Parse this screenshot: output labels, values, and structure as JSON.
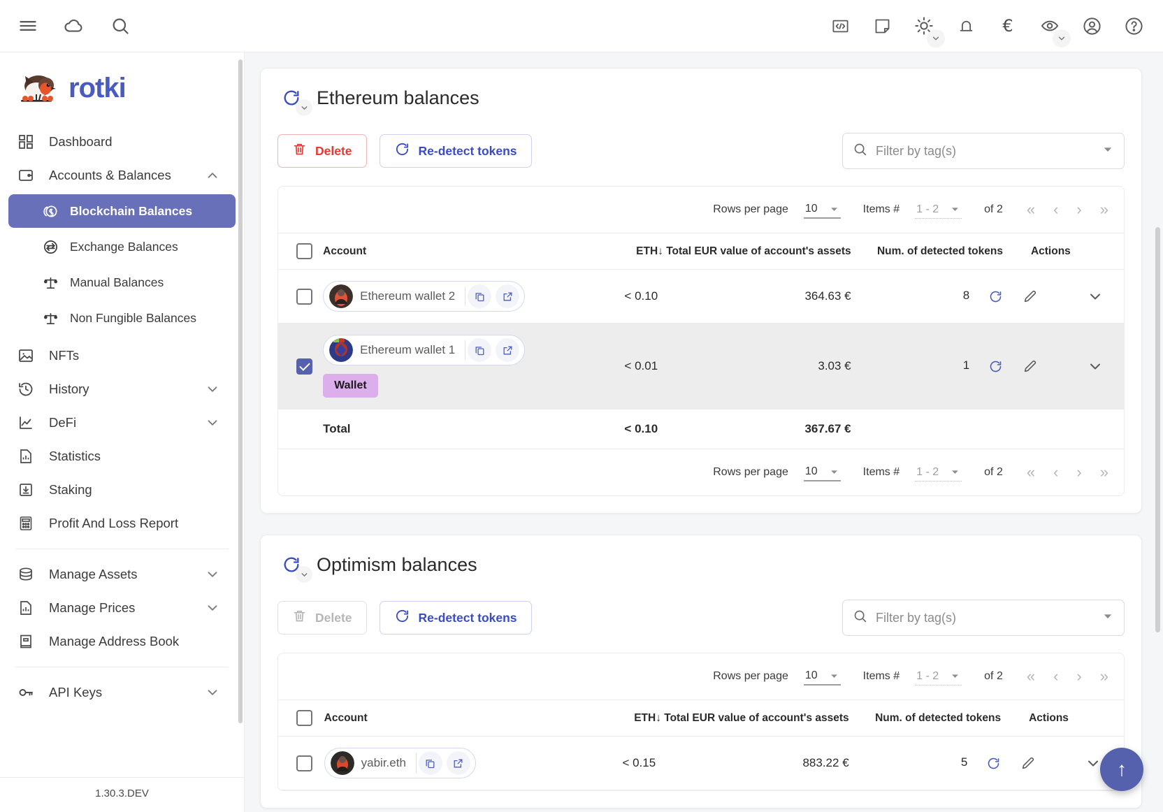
{
  "topbar": {
    "left_icons": [
      {
        "name": "menu-icon",
        "label": "Menu"
      },
      {
        "name": "cloud-icon",
        "label": "Cloud sync"
      },
      {
        "name": "search-icon",
        "label": "Search"
      }
    ],
    "right_icons": [
      {
        "name": "code-icon",
        "label": "Developer"
      },
      {
        "name": "note-icon",
        "label": "Notes"
      },
      {
        "name": "sun-icon",
        "label": "Theme"
      },
      {
        "name": "bell-icon",
        "label": "Notifications"
      },
      {
        "name": "euro-icon",
        "label": "€"
      },
      {
        "name": "eye-icon",
        "label": "Privacy mode"
      },
      {
        "name": "account-icon",
        "label": "Account"
      },
      {
        "name": "help-icon",
        "label": "Help"
      }
    ]
  },
  "sidebar": {
    "brand": "rotki",
    "version": "1.30.3.DEV",
    "items": [
      {
        "label": "Dashboard",
        "icon": "dashboard-icon",
        "type": "item"
      },
      {
        "label": "Accounts & Balances",
        "icon": "wallet-icon",
        "type": "group",
        "expanded": true
      },
      {
        "label": "Blockchain Balances",
        "icon": "coins-icon",
        "type": "sub",
        "active": true
      },
      {
        "label": "Exchange Balances",
        "icon": "exchange-icon",
        "type": "sub",
        "active": false
      },
      {
        "label": "Manual Balances",
        "icon": "scale-icon",
        "type": "sub",
        "active": false
      },
      {
        "label": "Non Fungible Balances",
        "icon": "scale-icon",
        "type": "sub",
        "active": false
      },
      {
        "label": "NFTs",
        "icon": "image-icon",
        "type": "item"
      },
      {
        "label": "History",
        "icon": "history-icon",
        "type": "group",
        "expanded": false
      },
      {
        "label": "DeFi",
        "icon": "chart-line-icon",
        "type": "group",
        "expanded": false
      },
      {
        "label": "Statistics",
        "icon": "statistics-icon",
        "type": "item"
      },
      {
        "label": "Staking",
        "icon": "staking-icon",
        "type": "item"
      },
      {
        "label": "Profit And Loss Report",
        "icon": "calculator-icon",
        "type": "item"
      },
      {
        "label": "Manage Assets",
        "icon": "database-icon",
        "type": "group",
        "expanded": false
      },
      {
        "label": "Manage Prices",
        "icon": "prices-icon",
        "type": "group",
        "expanded": false
      },
      {
        "label": "Manage Address Book",
        "icon": "book-icon",
        "type": "item"
      },
      {
        "label": "API Keys",
        "icon": "key-icon",
        "type": "group",
        "expanded": false
      }
    ]
  },
  "sections": [
    {
      "title": "Ethereum balances",
      "delete_label": "Delete",
      "delete_disabled": false,
      "redetect_label": "Re-detect tokens",
      "tag_filter_placeholder": "Filter by tag(s)",
      "pager": {
        "rows_per_page_label": "Rows per page",
        "rows_per_page_value": "10",
        "items_label": "Items #",
        "items_value": "1 - 2",
        "of_label": "of 2"
      },
      "columns": [
        "Account",
        "ETH",
        "Total EUR value of account's assets",
        "Num. of detected tokens",
        "Actions"
      ],
      "sorted_column": "Total EUR value of account's assets",
      "sort_direction": "desc",
      "rows": [
        {
          "checked": false,
          "account": "Ethereum wallet 2",
          "eth": "< 0.10",
          "value": "364.63 €",
          "tokens": "8",
          "tag": null,
          "avatar": "avatar-orange"
        },
        {
          "checked": true,
          "account": "Ethereum wallet 1",
          "eth": "< 0.01",
          "value": "3.03 €",
          "tokens": "1",
          "tag": "Wallet",
          "avatar": "avatar-blue"
        }
      ],
      "total": {
        "label": "Total",
        "eth": "< 0.10",
        "value": "367.67 €"
      }
    },
    {
      "title": "Optimism balances",
      "delete_label": "Delete",
      "delete_disabled": true,
      "redetect_label": "Re-detect tokens",
      "tag_filter_placeholder": "Filter by tag(s)",
      "pager": {
        "rows_per_page_label": "Rows per page",
        "rows_per_page_value": "10",
        "items_label": "Items #",
        "items_value": "1 - 2",
        "of_label": "of 2"
      },
      "columns": [
        "Account",
        "ETH",
        "Total EUR value of account's assets",
        "Num. of detected tokens",
        "Actions"
      ],
      "sorted_column": "Total EUR value of account's assets",
      "sort_direction": "desc",
      "rows": [
        {
          "checked": false,
          "account": "yabir.eth",
          "eth": "< 0.15",
          "value": "883.22 €",
          "tokens": "5",
          "tag": null,
          "avatar": "avatar-orange"
        }
      ],
      "total": null
    }
  ],
  "colors": {
    "accent": "#5561ad",
    "brand": "#4a5bbf",
    "danger": "#e53935",
    "tag_wallet": "#ddaeec",
    "selected_row": "#ededed"
  },
  "fab": {
    "name": "scroll-to-top",
    "glyph": "↑"
  }
}
